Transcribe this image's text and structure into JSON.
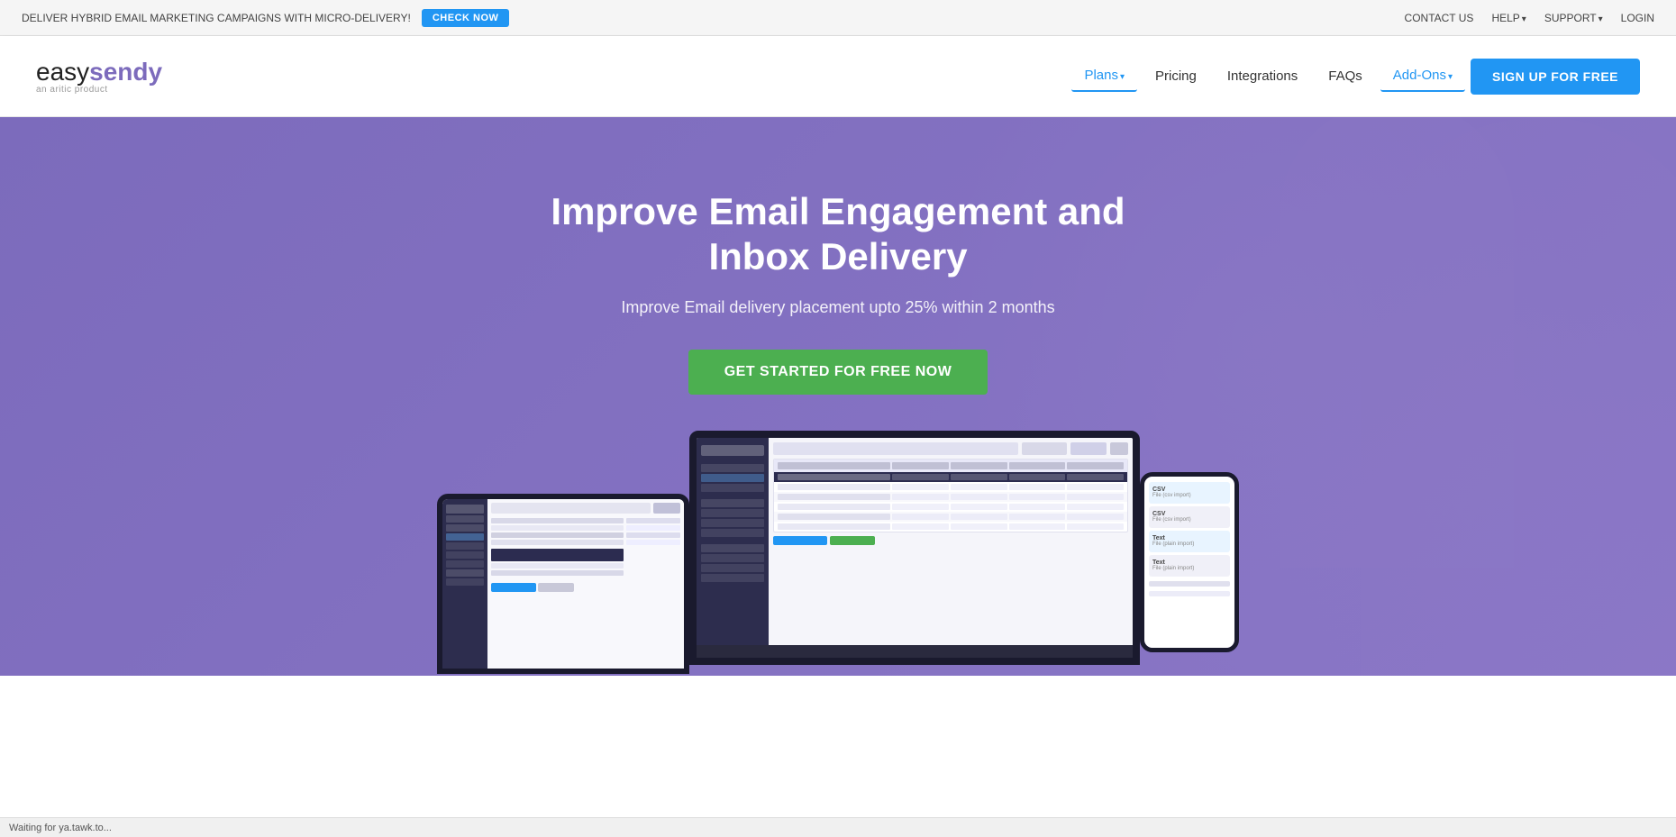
{
  "topbar": {
    "announcement": "DELIVER HYBRID EMAIL MARKETING CAMPAIGNS WITH MICRO-DELIVERY!",
    "check_now": "CHECK NOW",
    "contact_us": "CONTACT US",
    "help": "HELP",
    "support": "SUPPORT",
    "login": "LOGIN"
  },
  "nav": {
    "logo_easy": "easy",
    "logo_sendy": "sendy",
    "logo_sub": "an aritic product",
    "plans": "Plans",
    "pricing": "Pricing",
    "integrations": "Integrations",
    "faqs": "FAQs",
    "addons": "Add-Ons",
    "signup": "SIGN UP FOR FREE"
  },
  "hero": {
    "title": "Improve Email Engagement and Inbox Delivery",
    "subtitle": "Improve Email delivery placement upto 25% within 2 months",
    "cta": "GET STARTED FOR FREE NOW"
  },
  "statusbar": {
    "text": "Waiting for ya.tawk.to..."
  },
  "colors": {
    "brand_purple": "#7c6bbc",
    "cta_green": "#4caf50",
    "nav_blue": "#2196f3"
  }
}
